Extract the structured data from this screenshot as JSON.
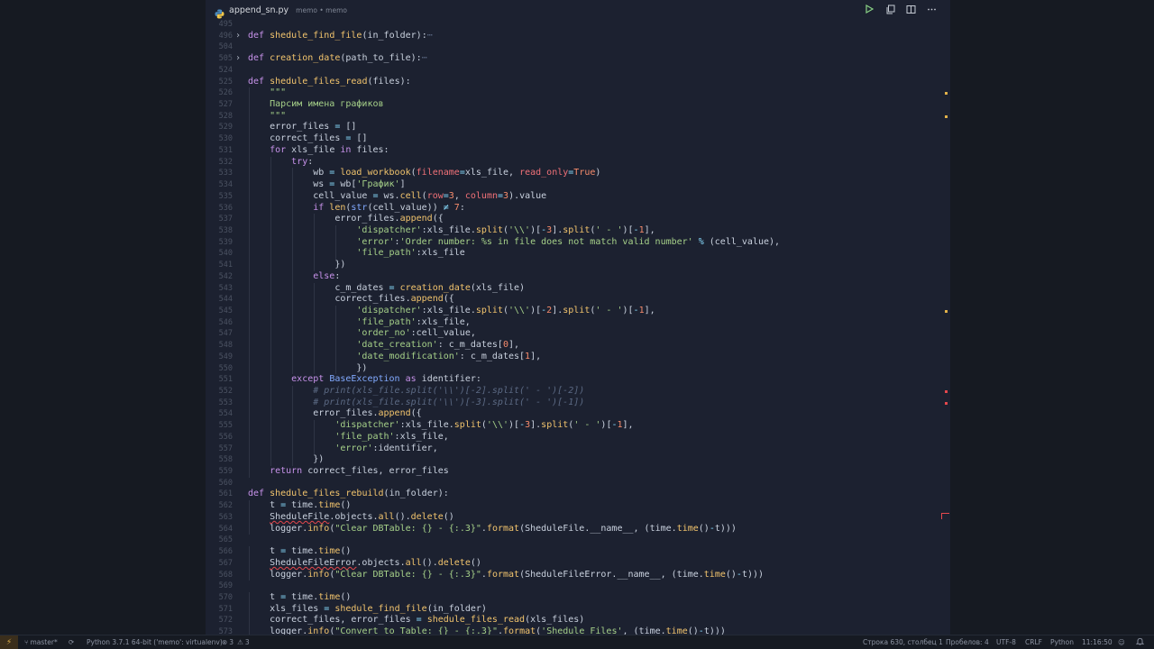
{
  "tab": {
    "filename": "append_sn.py",
    "description": "memo • memo"
  },
  "colors": {
    "background": "#161a22",
    "editor": "#1c2130",
    "keyword": "#c792ea",
    "function": "#f2c46d",
    "string": "#a6d189",
    "number": "#f78c6c",
    "comment": "#5c6a84"
  },
  "editor_actions": [
    {
      "name": "run-icon",
      "glyph": "▷"
    },
    {
      "name": "open-changes-icon",
      "glyph": "⧉"
    },
    {
      "name": "split-editor-icon",
      "glyph": "◫"
    },
    {
      "name": "more-actions-icon",
      "glyph": "⋯"
    }
  ],
  "code_lines": [
    {
      "n": "495",
      "indent": 0,
      "tokens": []
    },
    {
      "n": "496",
      "indent": 0,
      "fold": "›",
      "tokens": [
        [
          "k",
          "def "
        ],
        [
          "f",
          "shedule_find_file"
        ],
        [
          "w",
          "("
        ],
        [
          "w",
          "in_folder"
        ],
        [
          "w",
          "):"
        ],
        [
          "c",
          "⋯"
        ]
      ]
    },
    {
      "n": "504",
      "indent": 0,
      "tokens": []
    },
    {
      "n": "505",
      "indent": 0,
      "fold": "›",
      "tokens": [
        [
          "k",
          "def "
        ],
        [
          "f",
          "creation_date"
        ],
        [
          "w",
          "("
        ],
        [
          "w",
          "path_to_file"
        ],
        [
          "w",
          "):"
        ],
        [
          "c",
          "⋯"
        ]
      ]
    },
    {
      "n": "524",
      "indent": 0,
      "tokens": []
    },
    {
      "n": "525",
      "indent": 0,
      "tokens": [
        [
          "k",
          "def "
        ],
        [
          "f",
          "shedule_files_read"
        ],
        [
          "w",
          "("
        ],
        [
          "w",
          "files"
        ],
        [
          "w",
          "):"
        ]
      ]
    },
    {
      "n": "526",
      "indent": 1,
      "tokens": [
        [
          "s",
          "\"\"\""
        ]
      ]
    },
    {
      "n": "527",
      "indent": 1,
      "tokens": [
        [
          "s",
          "Парсим имена графиков"
        ]
      ]
    },
    {
      "n": "528",
      "indent": 1,
      "tokens": [
        [
          "s",
          "\"\"\""
        ]
      ]
    },
    {
      "n": "529",
      "indent": 1,
      "tokens": [
        [
          "w",
          "error_files "
        ],
        [
          "p",
          "= "
        ],
        [
          "w",
          "[]"
        ]
      ]
    },
    {
      "n": "530",
      "indent": 1,
      "tokens": [
        [
          "w",
          "correct_files "
        ],
        [
          "p",
          "= "
        ],
        [
          "w",
          "[]"
        ]
      ]
    },
    {
      "n": "531",
      "indent": 1,
      "tokens": [
        [
          "k",
          "for "
        ],
        [
          "w",
          "xls_file "
        ],
        [
          "k",
          "in "
        ],
        [
          "w",
          "files:"
        ]
      ]
    },
    {
      "n": "532",
      "indent": 2,
      "tokens": [
        [
          "k",
          "try"
        ],
        [
          "w",
          ":"
        ]
      ]
    },
    {
      "n": "533",
      "indent": 3,
      "tokens": [
        [
          "w",
          "wb "
        ],
        [
          "p",
          "= "
        ],
        [
          "f",
          "load_workbook"
        ],
        [
          "w",
          "("
        ],
        [
          "o",
          "filename"
        ],
        [
          "p",
          "="
        ],
        [
          "w",
          "xls_file, "
        ],
        [
          "o",
          "read_only"
        ],
        [
          "p",
          "="
        ],
        [
          "n",
          "True"
        ],
        [
          "w",
          ")"
        ]
      ]
    },
    {
      "n": "534",
      "indent": 3,
      "tokens": [
        [
          "w",
          "ws "
        ],
        [
          "p",
          "= "
        ],
        [
          "w",
          "wb["
        ],
        [
          "s",
          "'График'"
        ],
        [
          "w",
          "]"
        ]
      ]
    },
    {
      "n": "535",
      "indent": 3,
      "tokens": [
        [
          "w",
          "cell_value "
        ],
        [
          "p",
          "= "
        ],
        [
          "w",
          "ws."
        ],
        [
          "f",
          "cell"
        ],
        [
          "w",
          "("
        ],
        [
          "o",
          "row"
        ],
        [
          "p",
          "="
        ],
        [
          "n",
          "3"
        ],
        [
          "w",
          ", "
        ],
        [
          "o",
          "column"
        ],
        [
          "p",
          "="
        ],
        [
          "n",
          "3"
        ],
        [
          "w",
          ").value"
        ]
      ]
    },
    {
      "n": "536",
      "indent": 3,
      "tokens": [
        [
          "k",
          "if "
        ],
        [
          "f",
          "len"
        ],
        [
          "w",
          "("
        ],
        [
          "b",
          "str"
        ],
        [
          "w",
          "(cell_value)) "
        ],
        [
          "p",
          "≠ "
        ],
        [
          "n",
          "7"
        ],
        [
          "w",
          ":"
        ]
      ]
    },
    {
      "n": "537",
      "indent": 4,
      "tokens": [
        [
          "w",
          "error_files."
        ],
        [
          "f",
          "append"
        ],
        [
          "w",
          "({"
        ]
      ]
    },
    {
      "n": "538",
      "indent": 5,
      "tokens": [
        [
          "s",
          "'dispatcher'"
        ],
        [
          "w",
          ":xls_file."
        ],
        [
          "f",
          "split"
        ],
        [
          "w",
          "("
        ],
        [
          "s",
          "'\\\\'"
        ],
        [
          "w",
          ")["
        ],
        [
          "p",
          "-"
        ],
        [
          "n",
          "3"
        ],
        [
          "w",
          "]."
        ],
        [
          "f",
          "split"
        ],
        [
          "w",
          "("
        ],
        [
          "s",
          "' - '"
        ],
        [
          "w",
          ")["
        ],
        [
          "p",
          "-"
        ],
        [
          "n",
          "1"
        ],
        [
          "w",
          "],"
        ]
      ]
    },
    {
      "n": "539",
      "indent": 5,
      "tokens": [
        [
          "s",
          "'error'"
        ],
        [
          "w",
          ":"
        ],
        [
          "s",
          "'Order number: %s in file does not match valid number'"
        ],
        [
          "w",
          " "
        ],
        [
          "p",
          "% "
        ],
        [
          "w",
          "(cell_value),"
        ]
      ]
    },
    {
      "n": "540",
      "indent": 5,
      "tokens": [
        [
          "s",
          "'file_path'"
        ],
        [
          "w",
          ":xls_file"
        ]
      ]
    },
    {
      "n": "541",
      "indent": 4,
      "tokens": [
        [
          "w",
          "})"
        ]
      ]
    },
    {
      "n": "542",
      "indent": 3,
      "tokens": [
        [
          "k",
          "else"
        ],
        [
          "w",
          ":"
        ]
      ]
    },
    {
      "n": "543",
      "indent": 4,
      "tokens": [
        [
          "w",
          "c_m_dates "
        ],
        [
          "p",
          "= "
        ],
        [
          "f",
          "creation_date"
        ],
        [
          "w",
          "(xls_file)"
        ]
      ]
    },
    {
      "n": "544",
      "indent": 4,
      "tokens": [
        [
          "w",
          "correct_files."
        ],
        [
          "f",
          "append"
        ],
        [
          "w",
          "({"
        ]
      ]
    },
    {
      "n": "545",
      "indent": 5,
      "tokens": [
        [
          "s",
          "'dispatcher'"
        ],
        [
          "w",
          ":xls_file."
        ],
        [
          "f",
          "split"
        ],
        [
          "w",
          "("
        ],
        [
          "s",
          "'\\\\'"
        ],
        [
          "w",
          ")["
        ],
        [
          "p",
          "-"
        ],
        [
          "n",
          "2"
        ],
        [
          "w",
          "]."
        ],
        [
          "f",
          "split"
        ],
        [
          "w",
          "("
        ],
        [
          "s",
          "' - '"
        ],
        [
          "w",
          ")["
        ],
        [
          "p",
          "-"
        ],
        [
          "n",
          "1"
        ],
        [
          "w",
          "],"
        ]
      ]
    },
    {
      "n": "546",
      "indent": 5,
      "tokens": [
        [
          "s",
          "'file_path'"
        ],
        [
          "w",
          ":xls_file,"
        ]
      ]
    },
    {
      "n": "547",
      "indent": 5,
      "tokens": [
        [
          "s",
          "'order_no'"
        ],
        [
          "w",
          ":cell_value,"
        ]
      ]
    },
    {
      "n": "548",
      "indent": 5,
      "tokens": [
        [
          "s",
          "'date_creation'"
        ],
        [
          "w",
          ": c_m_dates["
        ],
        [
          "n",
          "0"
        ],
        [
          "w",
          "],"
        ]
      ]
    },
    {
      "n": "549",
      "indent": 5,
      "tokens": [
        [
          "s",
          "'date_modification'"
        ],
        [
          "w",
          ": c_m_dates["
        ],
        [
          "n",
          "1"
        ],
        [
          "w",
          "],"
        ]
      ]
    },
    {
      "n": "550",
      "indent": 5,
      "tokens": [
        [
          "w",
          "})"
        ]
      ]
    },
    {
      "n": "551",
      "indent": 2,
      "tokens": [
        [
          "k",
          "except "
        ],
        [
          "t",
          "BaseException "
        ],
        [
          "k",
          "as "
        ],
        [
          "w",
          "identifier:"
        ]
      ]
    },
    {
      "n": "552",
      "indent": 3,
      "tokens": [
        [
          "c",
          "# print(xls_file.split('\\\\')[-2].split(' - ')[-2])"
        ]
      ]
    },
    {
      "n": "553",
      "indent": 3,
      "tokens": [
        [
          "c",
          "# print(xls_file.split('\\\\')[-3].split(' - ')[-1])"
        ]
      ]
    },
    {
      "n": "554",
      "indent": 3,
      "tokens": [
        [
          "w",
          "error_files."
        ],
        [
          "f",
          "append"
        ],
        [
          "w",
          "({"
        ]
      ]
    },
    {
      "n": "555",
      "indent": 4,
      "tokens": [
        [
          "s",
          "'dispatcher'"
        ],
        [
          "w",
          ":xls_file."
        ],
        [
          "f",
          "split"
        ],
        [
          "w",
          "("
        ],
        [
          "s",
          "'\\\\'"
        ],
        [
          "w",
          ")["
        ],
        [
          "p",
          "-"
        ],
        [
          "n",
          "3"
        ],
        [
          "w",
          "]."
        ],
        [
          "f",
          "split"
        ],
        [
          "w",
          "("
        ],
        [
          "s",
          "' - '"
        ],
        [
          "w",
          ")["
        ],
        [
          "p",
          "-"
        ],
        [
          "n",
          "1"
        ],
        [
          "w",
          "],"
        ]
      ]
    },
    {
      "n": "556",
      "indent": 4,
      "tokens": [
        [
          "s",
          "'file_path'"
        ],
        [
          "w",
          ":xls_file,"
        ]
      ]
    },
    {
      "n": "557",
      "indent": 4,
      "tokens": [
        [
          "s",
          "'error'"
        ],
        [
          "w",
          ":identifier,"
        ]
      ]
    },
    {
      "n": "558",
      "indent": 3,
      "tokens": [
        [
          "w",
          "})"
        ]
      ]
    },
    {
      "n": "559",
      "indent": 1,
      "tokens": [
        [
          "k",
          "return "
        ],
        [
          "w",
          "correct_files, error_files"
        ]
      ]
    },
    {
      "n": "560",
      "indent": 0,
      "tokens": []
    },
    {
      "n": "561",
      "indent": 0,
      "tokens": [
        [
          "k",
          "def "
        ],
        [
          "f",
          "shedule_files_rebuild"
        ],
        [
          "w",
          "("
        ],
        [
          "w",
          "in_folder"
        ],
        [
          "w",
          "):"
        ]
      ]
    },
    {
      "n": "562",
      "indent": 1,
      "tokens": [
        [
          "w",
          "t "
        ],
        [
          "p",
          "= "
        ],
        [
          "w",
          "time."
        ],
        [
          "f",
          "time"
        ],
        [
          "w",
          "()"
        ]
      ]
    },
    {
      "n": "563",
      "indent": 1,
      "tokens": [
        [
          "err",
          "SheduleFile"
        ],
        [
          "w",
          ".objects."
        ],
        [
          "f",
          "all"
        ],
        [
          "w",
          "()."
        ],
        [
          "f",
          "delete"
        ],
        [
          "w",
          "()"
        ]
      ]
    },
    {
      "n": "564",
      "indent": 1,
      "tokens": [
        [
          "w",
          "logger."
        ],
        [
          "f",
          "info"
        ],
        [
          "w",
          "("
        ],
        [
          "s",
          "\"Clear DBTable: {} - {:.3}\""
        ],
        [
          "w",
          "."
        ],
        [
          "f",
          "format"
        ],
        [
          "w",
          "(SheduleFile.__name__, (time."
        ],
        [
          "f",
          "time"
        ],
        [
          "w",
          "()"
        ],
        [
          "p",
          "-"
        ],
        [
          "w",
          "t)))"
        ]
      ]
    },
    {
      "n": "565",
      "indent": 0,
      "tokens": []
    },
    {
      "n": "566",
      "indent": 1,
      "tokens": [
        [
          "w",
          "t "
        ],
        [
          "p",
          "= "
        ],
        [
          "w",
          "time."
        ],
        [
          "f",
          "time"
        ],
        [
          "w",
          "()"
        ]
      ]
    },
    {
      "n": "567",
      "indent": 1,
      "tokens": [
        [
          "err",
          "SheduleFileError"
        ],
        [
          "w",
          ".objects."
        ],
        [
          "f",
          "all"
        ],
        [
          "w",
          "()."
        ],
        [
          "f",
          "delete"
        ],
        [
          "w",
          "()"
        ]
      ]
    },
    {
      "n": "568",
      "indent": 1,
      "tokens": [
        [
          "w",
          "logger."
        ],
        [
          "f",
          "info"
        ],
        [
          "w",
          "("
        ],
        [
          "s",
          "\"Clear DBTable: {} - {:.3}\""
        ],
        [
          "w",
          "."
        ],
        [
          "f",
          "format"
        ],
        [
          "w",
          "(SheduleFileError.__name__, (time."
        ],
        [
          "f",
          "time"
        ],
        [
          "w",
          "()"
        ],
        [
          "p",
          "-"
        ],
        [
          "w",
          "t)))"
        ]
      ]
    },
    {
      "n": "569",
      "indent": 0,
      "tokens": []
    },
    {
      "n": "570",
      "indent": 1,
      "tokens": [
        [
          "w",
          "t "
        ],
        [
          "p",
          "= "
        ],
        [
          "w",
          "time."
        ],
        [
          "f",
          "time"
        ],
        [
          "w",
          "()"
        ]
      ]
    },
    {
      "n": "571",
      "indent": 1,
      "tokens": [
        [
          "w",
          "xls_files "
        ],
        [
          "p",
          "= "
        ],
        [
          "f",
          "shedule_find_file"
        ],
        [
          "w",
          "(in_folder)"
        ]
      ]
    },
    {
      "n": "572",
      "indent": 1,
      "tokens": [
        [
          "w",
          "correct_files, error_files "
        ],
        [
          "p",
          "= "
        ],
        [
          "f",
          "shedule_files_read"
        ],
        [
          "w",
          "(xls_files)"
        ]
      ]
    },
    {
      "n": "573",
      "indent": 1,
      "tokens": [
        [
          "w",
          "logger."
        ],
        [
          "f",
          "info"
        ],
        [
          "w",
          "("
        ],
        [
          "s",
          "\"Convert to Table: {} - {:.3}\""
        ],
        [
          "w",
          "."
        ],
        [
          "f",
          "format"
        ],
        [
          "w",
          "("
        ],
        [
          "s",
          "'Shedule Files'"
        ],
        [
          "w",
          ", (time."
        ],
        [
          "f",
          "time"
        ],
        [
          "w",
          "()"
        ],
        [
          "p",
          "-"
        ],
        [
          "w",
          "t)))"
        ]
      ]
    },
    {
      "n": "574",
      "indent": 0,
      "tokens": []
    }
  ],
  "ruler_markers": [
    {
      "line": 526,
      "color": "#e2b24a"
    },
    {
      "line": 528,
      "color": "#e2b24a"
    },
    {
      "line": 545,
      "color": "#e2b24a"
    },
    {
      "line": 552,
      "color": "#e5484d"
    },
    {
      "line": 553,
      "color": "#e5484d"
    }
  ],
  "status": {
    "remote_glyph": "⚡",
    "branch": "master*",
    "sync_glyph": "⟳",
    "interpreter": "Python 3.7.1 64-bit ('memo': virtualenv)",
    "errors_glyph": "⊗",
    "errors": "3",
    "warnings_glyph": "⚠",
    "warnings": "3",
    "position": "Строка 630, столбец 1",
    "spaces": "Пробелов: 4",
    "encoding": "UTF-8",
    "eol": "CRLF",
    "language": "Python",
    "time": "11:16:50",
    "feedback_glyph": "☺",
    "bell_glyph": "🔔"
  }
}
